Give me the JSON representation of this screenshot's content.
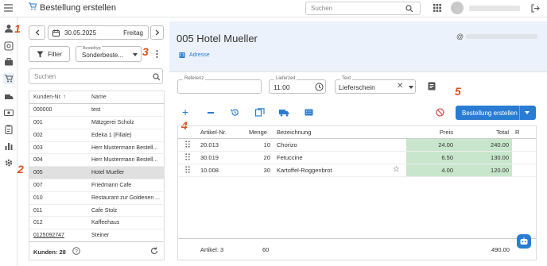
{
  "header": {
    "title": "Bestellung erstellen",
    "search_placeholder": "Suchen"
  },
  "rail": {
    "badges": [
      "1",
      "2"
    ]
  },
  "date": {
    "value": "30.05.2025",
    "weekday": "Freitag"
  },
  "filter": {
    "label": "Filter"
  },
  "bestelltyp": {
    "label": "Besteltyp",
    "value": "Sonderbeste..."
  },
  "cust_search": {
    "placeholder": "Suchen"
  },
  "cust_table": {
    "headers": [
      "Kunden-Nr.",
      "Name"
    ],
    "rows": [
      [
        "000000",
        "test"
      ],
      [
        "001",
        "Mätzgerei Scholz"
      ],
      [
        "002",
        "Edeka 1 (Filiale)"
      ],
      [
        "003",
        "Herr Mustermann Bestell..."
      ],
      [
        "004",
        "Herr Mustermann Bestell..."
      ],
      [
        "005",
        "Hotel Mueller"
      ],
      [
        "007",
        "Friedmann Cafe"
      ],
      [
        "010",
        "Restaurant zur Goldenen ..."
      ],
      [
        "011",
        "Cafe Stolz"
      ],
      [
        "012",
        "Kaffeehaus"
      ],
      [
        "0125092747",
        "Steiner"
      ]
    ],
    "selected": 5,
    "footer": "Kunden: 28"
  },
  "customer": {
    "title": "005 Hotel Mueller",
    "address_label": "Adresse"
  },
  "fields": {
    "referenz_label": "Referenz",
    "lieferzeit_label": "Lieferzeit",
    "lieferzeit_value": "11:00",
    "text_label": "Text",
    "text_value": "Lieferschein"
  },
  "actions": {
    "create_label": "Bestellung erstellen"
  },
  "badges": {
    "b3": "3",
    "b4": "4",
    "b5": "5"
  },
  "art_table": {
    "headers": [
      "Artikel-Nr.",
      "Menge",
      "Bezeichnung",
      "Preis",
      "Total",
      "R"
    ],
    "rows": [
      [
        "20.013",
        "10",
        "Chorizo",
        "24.00",
        "240.00"
      ],
      [
        "30.019",
        "20",
        "Fetuccine",
        "6.50",
        "130.00"
      ],
      [
        "10.008",
        "30",
        "Kartoffel-Roggenbrot",
        "4.00",
        "120.00"
      ]
    ],
    "footer_articles": "Artikel: 3",
    "footer_menge": "60",
    "footer_total": "490.00"
  }
}
